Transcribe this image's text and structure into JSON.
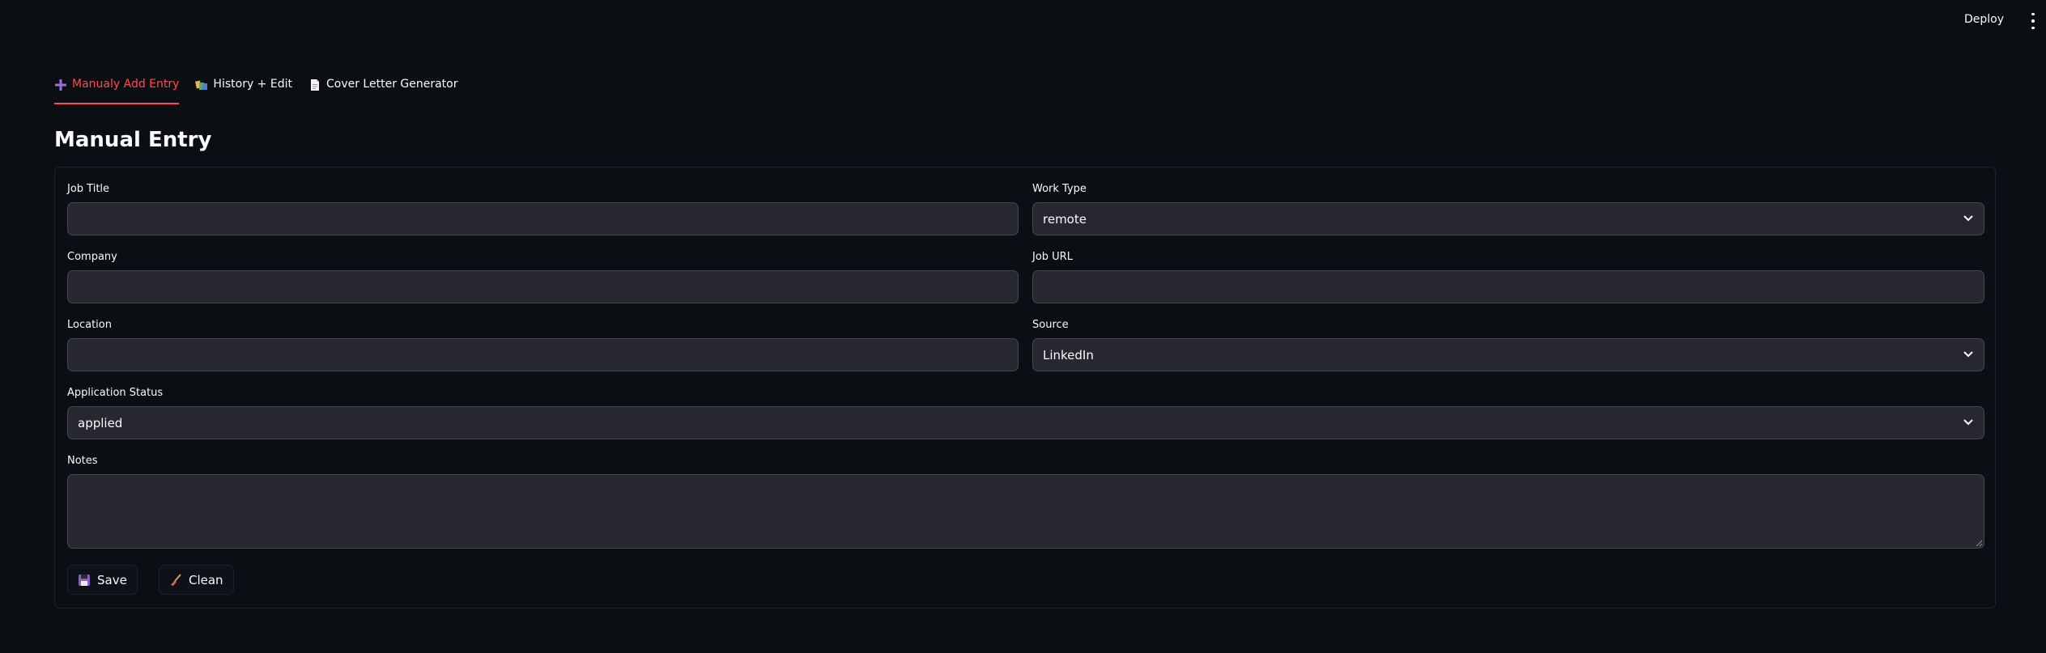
{
  "header": {
    "deploy_label": "Deploy",
    "menu_icon": "kebab-menu-icon"
  },
  "tabs": [
    {
      "label": "Manualy Add Entry",
      "icon": "plus-icon",
      "active": true
    },
    {
      "label": "History + Edit",
      "icon": "books-icon",
      "active": false
    },
    {
      "label": "Cover Letter Generator",
      "icon": "page-icon",
      "active": false
    }
  ],
  "page_title": "Manual Entry",
  "form": {
    "job_title": {
      "label": "Job Title",
      "value": ""
    },
    "work_type": {
      "label": "Work Type",
      "value": "remote"
    },
    "company": {
      "label": "Company",
      "value": ""
    },
    "job_url": {
      "label": "Job URL",
      "value": ""
    },
    "location": {
      "label": "Location",
      "value": ""
    },
    "source": {
      "label": "Source",
      "value": "LinkedIn"
    },
    "application_status": {
      "label": "Application Status",
      "value": "applied"
    },
    "notes": {
      "label": "Notes",
      "value": ""
    }
  },
  "buttons": {
    "save": {
      "label": "Save",
      "icon": "floppy-disk-icon"
    },
    "clean": {
      "label": "Clean",
      "icon": "broom-icon"
    }
  },
  "colors": {
    "accent": "#ff4b4b",
    "background": "#0b0e13",
    "input_bg": "#262730"
  }
}
